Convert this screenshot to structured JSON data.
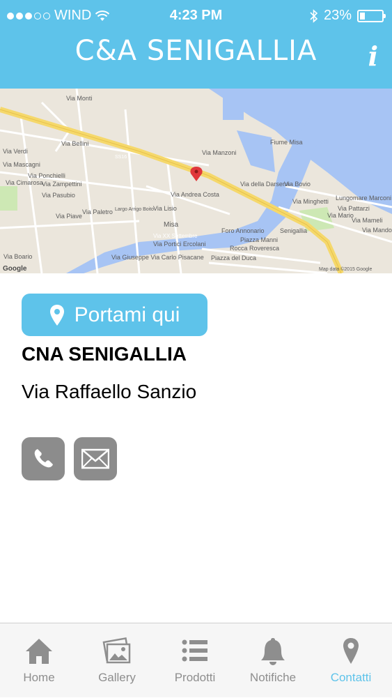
{
  "status_bar": {
    "carrier": "WIND",
    "time": "4:23 PM",
    "battery": "23%",
    "battery_level": 0.23
  },
  "header": {
    "title": "C&A SENIGALLIA",
    "info_label": "i"
  },
  "map": {
    "streets": [
      "Via Monti",
      "Via Bellini",
      "SS16",
      "Via Mascagni",
      "Via Verdi",
      "Via Cimarosa",
      "Via Ponchielli",
      "Via Zampettini",
      "Via Pasubio",
      "Via Paletro",
      "Via Piave",
      "Via Manzoni",
      "Via Andrea Costa",
      "Largo Arrigo Boito",
      "Via Lisio",
      "Misa",
      "Via XX Settembre",
      "Via Portici Ercolani",
      "Via Giuseppe Via Carlo Pisacane",
      "Foro Annonario",
      "Senigallia",
      "Piazza Manni",
      "Rocca Roveresca",
      "Piazza del Duca",
      "Via Boario",
      "Via Mario",
      "Lungomare Marconi",
      "Via Mameli",
      "Via Pattarzi",
      "Via Mandolfo",
      "Via Bovio",
      "Via Minghetti",
      "Fiume Misa",
      "Via della Darsena"
    ],
    "attribution": "Map data ©2015 Google",
    "logo": "Google"
  },
  "directions_button": {
    "label": "Portami qui"
  },
  "company": {
    "name": "CNA SENIGALLIA",
    "address": "Via Raffaello Sanzio"
  },
  "contact_icons": [
    "phone-icon",
    "mail-icon"
  ],
  "tabs": [
    {
      "label": "Home",
      "icon": "home-icon",
      "active": false
    },
    {
      "label": "Gallery",
      "icon": "gallery-icon",
      "active": false
    },
    {
      "label": "Prodotti",
      "icon": "list-icon",
      "active": false
    },
    {
      "label": "Notifiche",
      "icon": "bell-icon",
      "active": false
    },
    {
      "label": "Contatti",
      "icon": "pin-icon",
      "active": true
    }
  ],
  "colors": {
    "accent": "#5ec3ea",
    "contact_button": "#8c8c8c",
    "tab_inactive": "#8e8e8e"
  }
}
